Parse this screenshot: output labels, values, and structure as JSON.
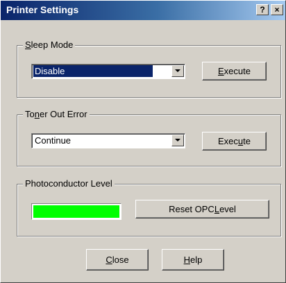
{
  "window": {
    "title": "Printer Settings",
    "help_button": "?",
    "close_button": "×"
  },
  "sleep_mode": {
    "label": [
      "",
      "S",
      "leep Mode"
    ],
    "selected": "Disable",
    "execute": [
      "",
      "E",
      "xecute"
    ]
  },
  "toner_out_error": {
    "label": [
      "To",
      "n",
      "er Out Error"
    ],
    "selected": "Continue",
    "execute": [
      "Exec",
      "u",
      "te"
    ]
  },
  "photoconductor_level": {
    "label": "Photoconductor Level",
    "level_percent": 100,
    "level_color": "#00ff00",
    "reset": [
      "Reset OPC ",
      "L",
      "evel"
    ]
  },
  "footer": {
    "close": [
      "",
      "C",
      "lose"
    ],
    "help": [
      "",
      "H",
      "elp"
    ]
  }
}
